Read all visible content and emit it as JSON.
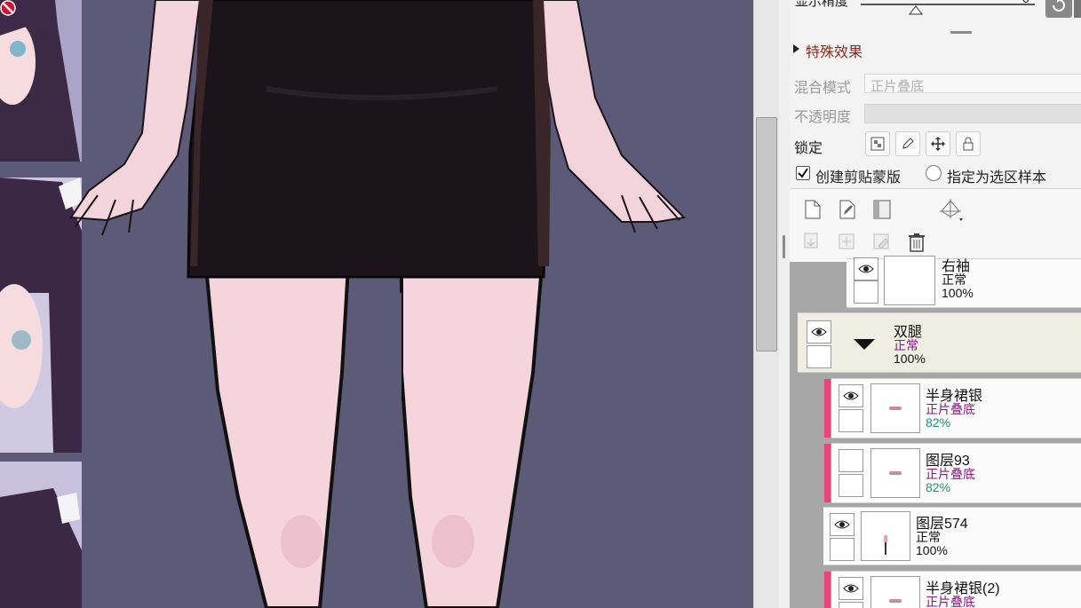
{
  "panel": {
    "top_label": "显示精度",
    "top_value": "0",
    "section_title": "特殊效果",
    "blend_mode_label": "混合模式",
    "blend_mode_value": "正片叠底",
    "opacity_label": "不透明度",
    "lock_label": "锁定",
    "clipping_label": "创建剪贴蒙版",
    "selection_source_label": "指定为选区样本"
  },
  "layers": [
    {
      "name": "右袖",
      "mode": "正常",
      "opacity": "100%"
    },
    {
      "name": "双腿",
      "mode": "正常",
      "opacity": "100%"
    },
    {
      "name": "半身裙银",
      "mode": "正片叠底",
      "opacity": "82%"
    },
    {
      "name": "图层93",
      "mode": "正片叠底",
      "opacity": "82%"
    },
    {
      "name": "图层574",
      "mode": "正常",
      "opacity": "100%"
    },
    {
      "name": "半身裙银(2)",
      "mode": "正片叠底",
      "opacity": ""
    }
  ],
  "colors": {
    "canvas_bg": "#5c5a76",
    "clip_marker": "#e8437b",
    "multiply_mode": "#8b1a7a",
    "opacity_teal": "#1f8f7a"
  }
}
